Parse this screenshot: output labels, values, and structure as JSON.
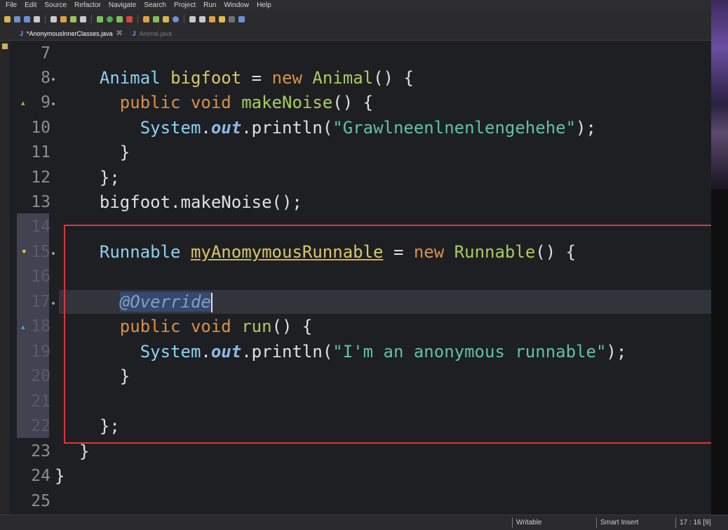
{
  "menu": [
    "File",
    "Edit",
    "Source",
    "Refactor",
    "Navigate",
    "Search",
    "Project",
    "Run",
    "Window",
    "Help"
  ],
  "tabs": [
    {
      "label": "*AnonymousInnerClasses.java",
      "active": true
    },
    {
      "label": "Animal.java",
      "active": false
    }
  ],
  "line_numbers": [
    "7",
    "8",
    "9",
    "10",
    "11",
    "12",
    "13",
    "14",
    "15",
    "16",
    "17",
    "18",
    "19",
    "20",
    "21",
    "22",
    "23",
    "24",
    "25"
  ],
  "code": {
    "l8": {
      "indent": "  ",
      "type": "Animal",
      "var": "bigfoot",
      "eq": " = ",
      "kw": "new",
      "cls": "Animal",
      "tail": "() {"
    },
    "l9": {
      "indent": "    ",
      "kw1": "public",
      "kw2": "void",
      "method": "makeNoise",
      "tail": "() {"
    },
    "l10": {
      "indent": "      ",
      "sys": "System",
      "dot1": ".",
      "out": "out",
      "dot2": ".println(",
      "str": "\"Grawlneenlnenlengehehe\"",
      "tail": ");"
    },
    "l11": {
      "text": "    }"
    },
    "l12": {
      "text": "  };"
    },
    "l13": {
      "text": "  bigfoot.makeNoise();"
    },
    "l15": {
      "indent": "  ",
      "type": "Runnable",
      "var": "myAnomymousRunnable",
      "eq": " = ",
      "kw": "new",
      "cls": "Runnable",
      "tail": "() {"
    },
    "l17": {
      "indent": "    ",
      "annot": "@Override"
    },
    "l18": {
      "indent": "    ",
      "kw1": "public",
      "kw2": "void",
      "method": "run",
      "tail": "() {"
    },
    "l19": {
      "indent": "      ",
      "sys": "System",
      "dot1": ".",
      "out": "out",
      "dot2": ".println(",
      "str": "\"I'm an anonymous runnable\"",
      "tail": ");"
    },
    "l20": {
      "text": "    }"
    },
    "l22": {
      "text": "  };"
    },
    "l23": {
      "text": "}"
    },
    "l24": {
      "text": "}"
    }
  },
  "status": {
    "writable": "Writable",
    "insert_mode": "Smart Insert",
    "position": "17 : 16 [9]"
  },
  "colors": {
    "highlight_box": "#e0353c",
    "background": "#1e1f22"
  }
}
